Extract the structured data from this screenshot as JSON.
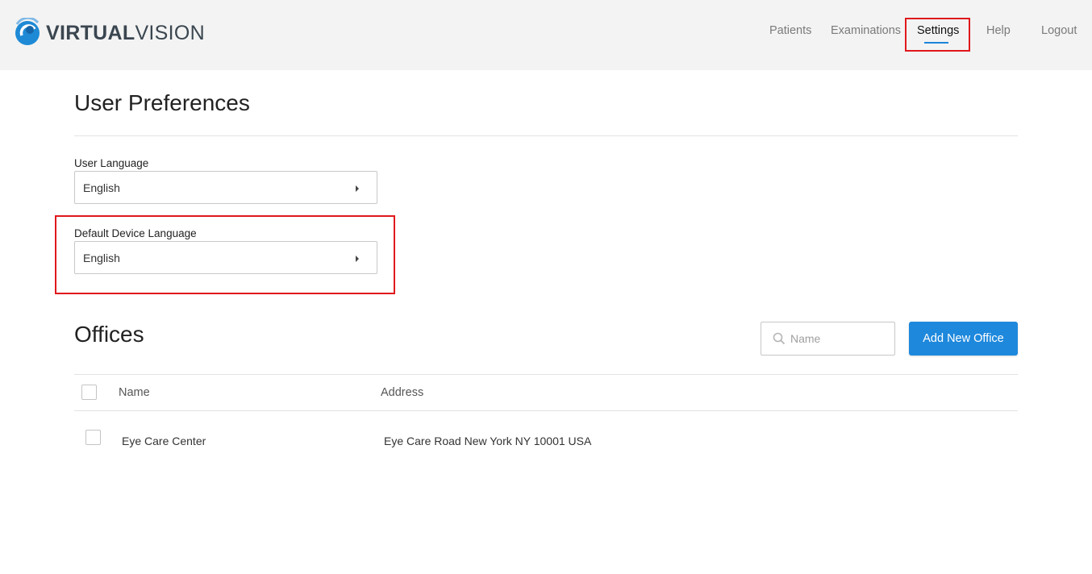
{
  "brand": {
    "bold": "VIRTUAL",
    "thin": "VISION"
  },
  "nav": {
    "items": [
      {
        "label": "Patients"
      },
      {
        "label": "Examinations"
      },
      {
        "label": "Settings"
      },
      {
        "label": "Help"
      },
      {
        "label": "Logout"
      }
    ],
    "active": "Settings"
  },
  "preferences": {
    "title": "User Preferences",
    "user_language": {
      "label": "User Language",
      "value": "English"
    },
    "device_language": {
      "label": "Default Device Language",
      "value": "English"
    }
  },
  "offices": {
    "title": "Offices",
    "search_placeholder": "Name",
    "add_button": "Add New Office",
    "columns": [
      "Name",
      "Address"
    ],
    "rows": [
      {
        "name": "Eye Care Center",
        "address": "Eye Care Road New York NY 10001 USA"
      }
    ]
  },
  "colors": {
    "accent": "#1e88dc",
    "highlight": "#e0181c",
    "header_bg": "#f3f3f3"
  },
  "icons": [
    "logo-eye-icon",
    "search-icon",
    "caret-right-icon"
  ]
}
